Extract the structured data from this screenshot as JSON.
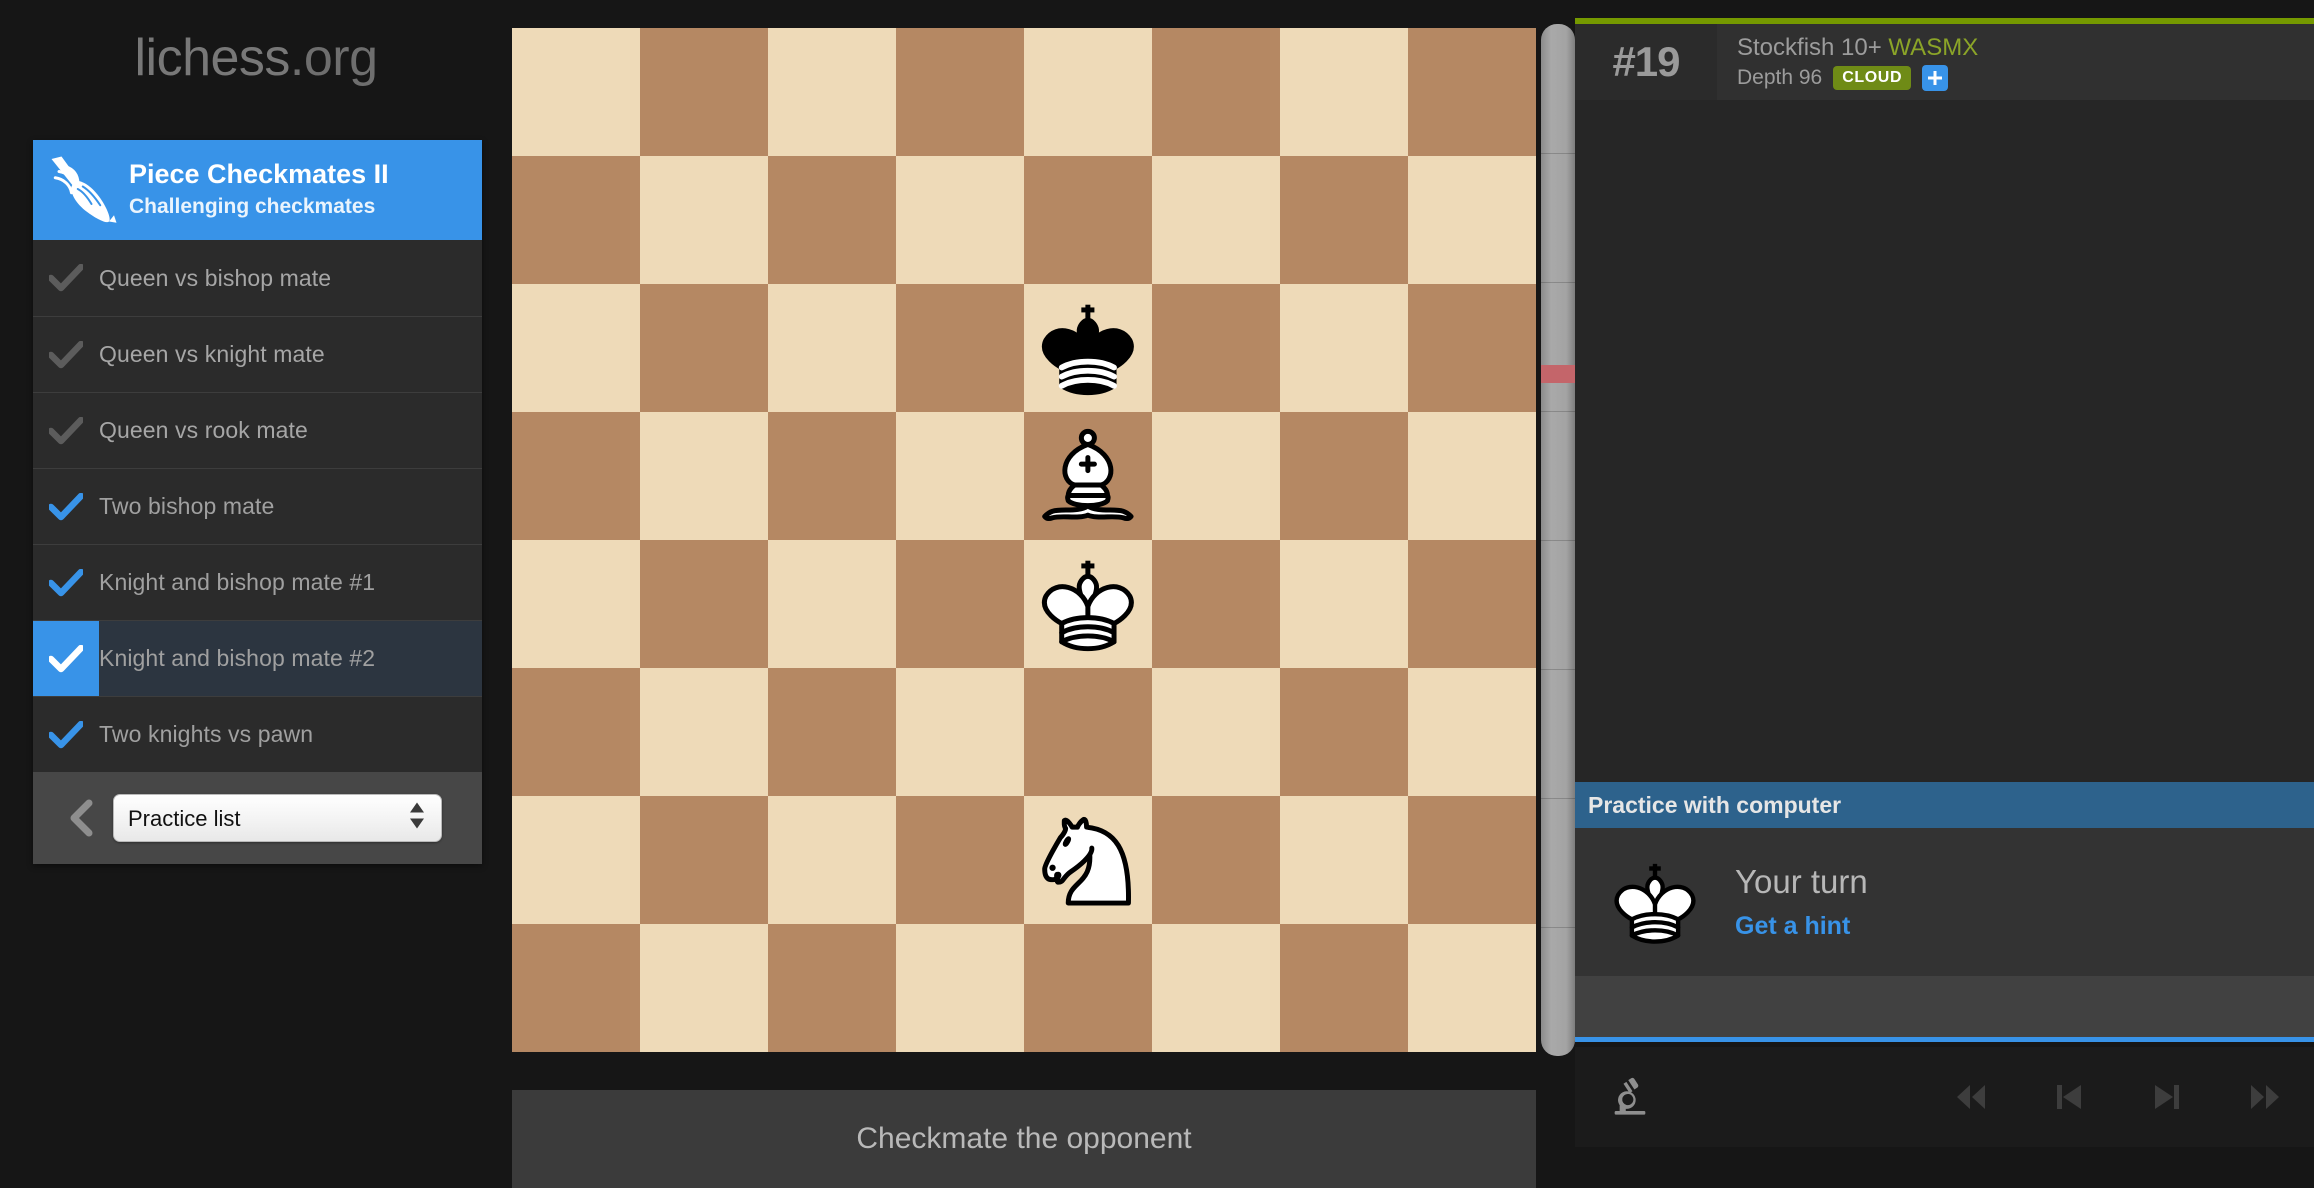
{
  "brand": {
    "name": "lichess",
    "tld": ".org"
  },
  "sidebar": {
    "header": {
      "icon": "spear-icon",
      "title": "Piece Checkmates II",
      "subtitle": "Challenging checkmates"
    },
    "items": [
      {
        "label": "Queen vs bishop mate",
        "state": "done",
        "check": "check-icon"
      },
      {
        "label": "Queen vs knight mate",
        "state": "done",
        "check": "check-icon"
      },
      {
        "label": "Queen vs rook mate",
        "state": "done",
        "check": "check-icon"
      },
      {
        "label": "Two bishop mate",
        "state": "solved",
        "check": "check-icon"
      },
      {
        "label": "Knight and bishop mate #1",
        "state": "solved",
        "check": "check-icon"
      },
      {
        "label": "Knight and bishop mate #2",
        "state": "active",
        "check": "check-icon"
      },
      {
        "label": "Two knights vs pawn",
        "state": "solved",
        "check": "check-icon"
      }
    ],
    "footer": {
      "back_icon": "chevron-left-icon",
      "select_value": "Practice list",
      "select_options": [
        "Practice list"
      ],
      "stepper_icon": "stepper-updown-icon"
    }
  },
  "board": {
    "light_color": "#eedab8",
    "dark_color": "#b58863",
    "pieces": [
      {
        "square": "e6",
        "piece": "black-king",
        "row": 3,
        "col": 5
      },
      {
        "square": "e5",
        "piece": "white-bishop",
        "row": 4,
        "col": 5
      },
      {
        "square": "e4",
        "piece": "white-king",
        "row": 5,
        "col": 5
      },
      {
        "square": "e2",
        "piece": "white-knight",
        "row": 7,
        "col": 5
      }
    ],
    "message": "Checkmate the opponent"
  },
  "evalbar": {
    "marker_color": "#c4656a",
    "marker_position_percent": 33
  },
  "right": {
    "engine": {
      "accent_color": "#759900",
      "number": "#19",
      "name": "Stockfish 10+",
      "variant": "WASMX",
      "depth": "Depth 96",
      "cloud_badge": "CLOUD",
      "add_icon": "plus-icon"
    },
    "practice": {
      "header": "Practice with computer",
      "piece_icon": "white-king-icon",
      "turn": "Your turn",
      "hint_link": "Get a hint"
    },
    "controls": {
      "analysis_icon": "microscope-icon",
      "first_icon": "jump-first-icon",
      "prev_icon": "step-prev-icon",
      "next_icon": "step-next-icon",
      "last_icon": "jump-last-icon"
    }
  }
}
